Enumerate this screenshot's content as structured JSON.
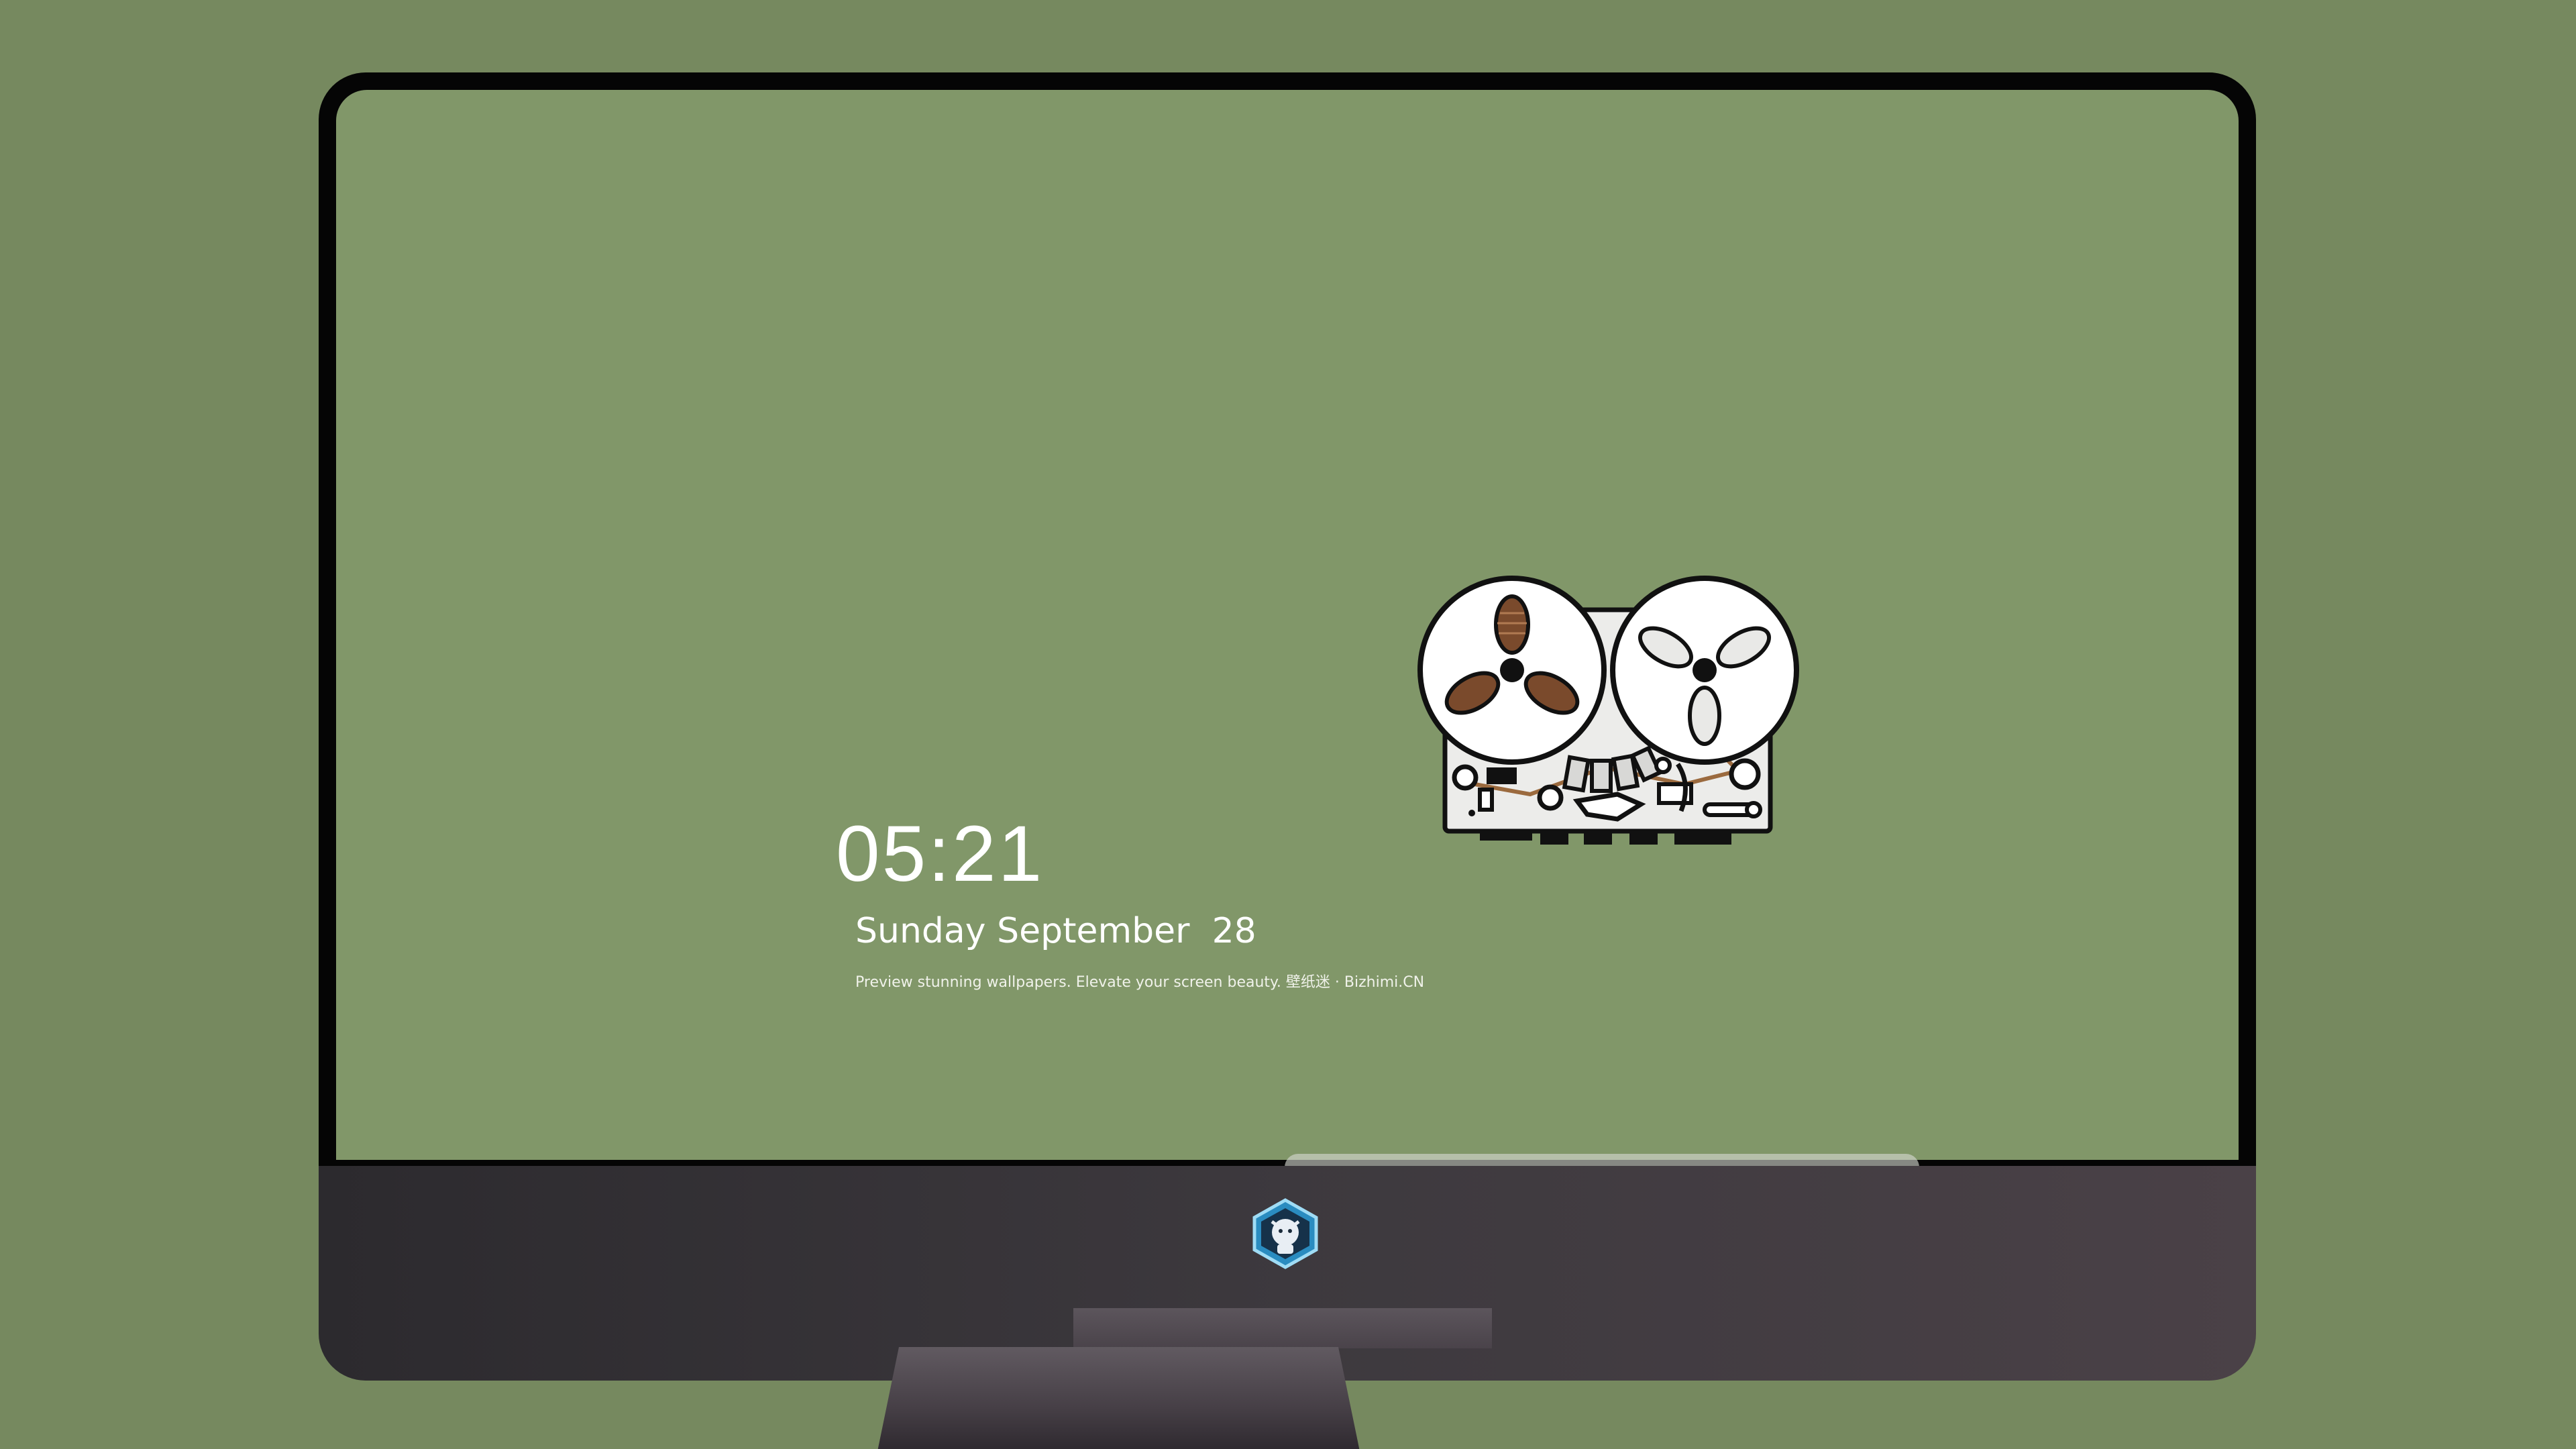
{
  "lockscreen": {
    "time": "05:21",
    "date": "Sunday September  28",
    "tagline": "Preview stunning wallpapers. Elevate your screen beauty. 壁纸迷 · Bizhimi.CN"
  },
  "colors": {
    "background": "#76895f",
    "screen": "#819769",
    "bezel": "#050505",
    "chin": "#3d393e"
  },
  "dock": {
    "apps": [
      {
        "name": "messages-icon"
      },
      {
        "name": "weather-icon"
      },
      {
        "name": "clock-icon"
      },
      {
        "name": "preview-icon"
      },
      {
        "name": "clapperboard-icon"
      },
      {
        "name": "notes-icon"
      },
      {
        "name": "photo-editor-icon"
      },
      {
        "name": "music-icon"
      },
      {
        "name": "app-store-icon"
      },
      {
        "name": "camera-icon"
      }
    ]
  }
}
